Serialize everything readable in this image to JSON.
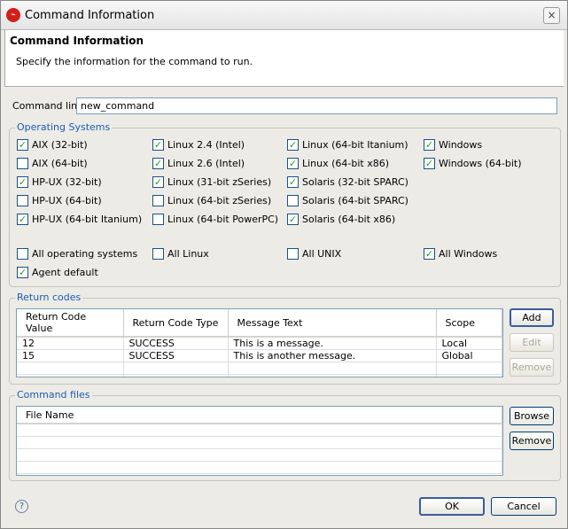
{
  "window": {
    "title": "Command Information",
    "close_icon": "×"
  },
  "header": {
    "title": "Command Information",
    "description": "Specify the information for the command to run."
  },
  "command_line": {
    "label": "Command line",
    "value": "new_command"
  },
  "os_group": {
    "title": "Operating Systems",
    "columns": [
      [
        {
          "label": "AIX (32-bit)",
          "checked": true
        },
        {
          "label": "AIX (64-bit)",
          "checked": false
        },
        {
          "label": "HP-UX (32-bit)",
          "checked": true
        },
        {
          "label": "HP-UX (64-bit)",
          "checked": false
        },
        {
          "label": "HP-UX (64-bit Itanium)",
          "checked": true
        }
      ],
      [
        {
          "label": "Linux 2.4 (Intel)",
          "checked": true
        },
        {
          "label": "Linux 2.6 (Intel)",
          "checked": true
        },
        {
          "label": "Linux (31-bit zSeries)",
          "checked": true
        },
        {
          "label": "Linux (64-bit zSeries)",
          "checked": false
        },
        {
          "label": "Linux (64-bit PowerPC)",
          "checked": false
        }
      ],
      [
        {
          "label": "Linux (64-bit Itanium)",
          "checked": true
        },
        {
          "label": "Linux (64-bit x86)",
          "checked": true
        },
        {
          "label": "Solaris (32-bit SPARC)",
          "checked": true
        },
        {
          "label": "Solaris (64-bit SPARC)",
          "checked": false
        },
        {
          "label": "Solaris (64-bit x86)",
          "checked": true
        }
      ],
      [
        {
          "label": "Windows",
          "checked": true
        },
        {
          "label": "Windows (64-bit)",
          "checked": true
        }
      ]
    ],
    "all": [
      {
        "label": "All operating systems",
        "checked": false
      },
      {
        "label": "All Linux",
        "checked": false
      },
      {
        "label": "All UNIX",
        "checked": false
      },
      {
        "label": "All Windows",
        "checked": true
      }
    ],
    "agent_default": {
      "label": "Agent default",
      "checked": true
    }
  },
  "return_codes": {
    "title": "Return codes",
    "headers": [
      "Return Code Value",
      "Return Code Type",
      "Message Text",
      "Scope"
    ],
    "rows": [
      [
        "12",
        "SUCCESS",
        "This is a message.",
        "Local"
      ],
      [
        "15",
        "SUCCESS",
        "This is another message.",
        "Global"
      ]
    ],
    "add": "Add",
    "edit": "Edit",
    "remove": "Remove"
  },
  "command_files": {
    "title": "Command files",
    "headers": [
      "File Name"
    ],
    "browse": "Browse",
    "remove": "Remove"
  },
  "footer": {
    "help": "?",
    "ok": "OK",
    "cancel": "Cancel"
  }
}
